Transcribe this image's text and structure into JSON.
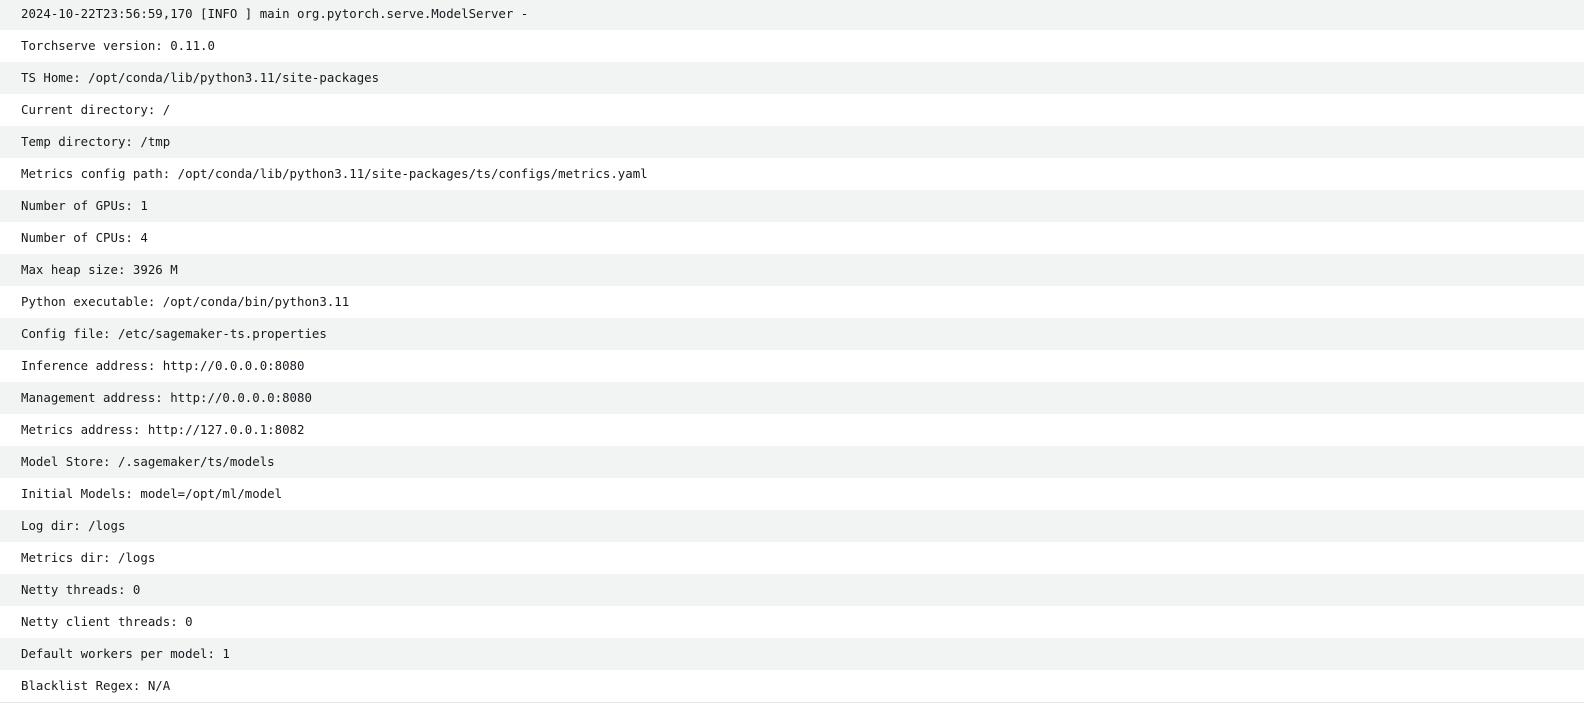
{
  "log": {
    "lines": [
      "2024-10-22T23:56:59,170 [INFO ] main org.pytorch.serve.ModelServer -",
      "Torchserve version: 0.11.0",
      "TS Home: /opt/conda/lib/python3.11/site-packages",
      "Current directory: /",
      "Temp directory: /tmp",
      "Metrics config path: /opt/conda/lib/python3.11/site-packages/ts/configs/metrics.yaml",
      "Number of GPUs: 1",
      "Number of CPUs: 4",
      "Max heap size: 3926 M",
      "Python executable: /opt/conda/bin/python3.11",
      "Config file: /etc/sagemaker-ts.properties",
      "Inference address: http://0.0.0.0:8080",
      "Management address: http://0.0.0.0:8080",
      "Metrics address: http://127.0.0.1:8082",
      "Model Store: /.sagemaker/ts/models",
      "Initial Models: model=/opt/ml/model",
      "Log dir: /logs",
      "Metrics dir: /logs",
      "Netty threads: 0",
      "Netty client threads: 0",
      "Default workers per model: 1",
      "Blacklist Regex: N/A"
    ]
  },
  "colors": {
    "stripe": "#f2f3f3",
    "background": "#ffffff",
    "text": "#16191f"
  }
}
